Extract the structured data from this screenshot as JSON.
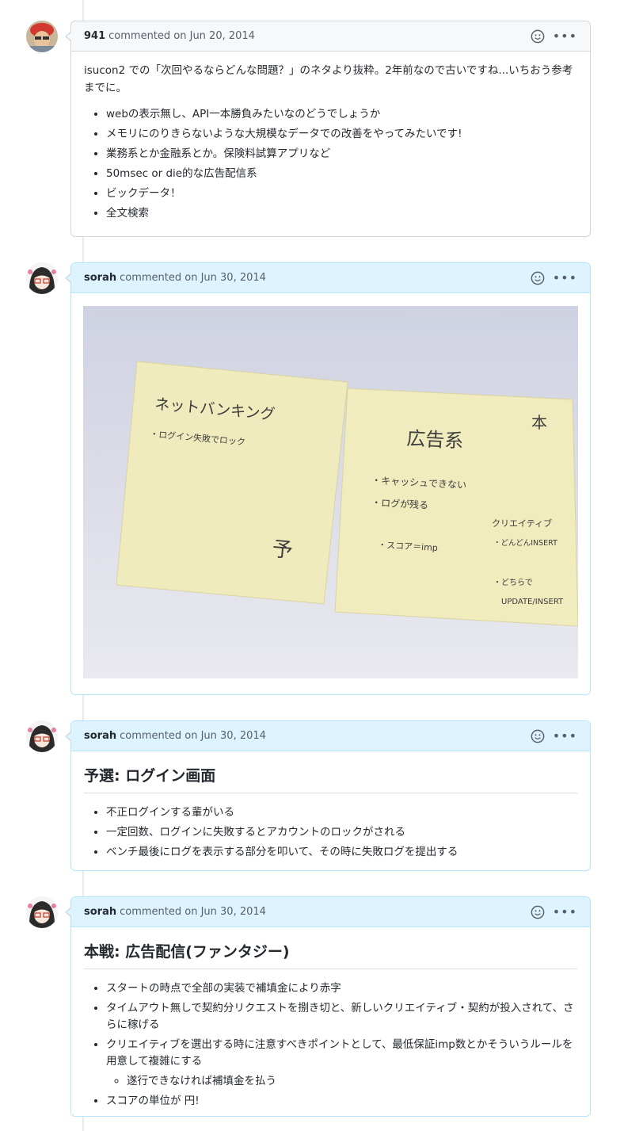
{
  "comments": [
    {
      "author": "941",
      "meta": "commented on Jun 20, 2014",
      "intro": "isucon2 での「次回やるならどんな問題？」のネタより抜粋。2年前なので古いですね...いちおう参考までに。",
      "items": [
        "webの表示無し、API一本勝負みたいなのどうでしょうか",
        "メモリにのりきらないような大規模なデータでの改善をやってみたいです!",
        "業務系とか金融系とか。保険料試算アプリなど",
        "50msec or die的な広告配信系",
        "ビックデータ！",
        "全文検索"
      ]
    },
    {
      "author": "sorah",
      "meta": "commented on Jun 30, 2014",
      "photo": {
        "note_left": {
          "title": "ネットバンキング",
          "line1": "・ログイン失敗でロック",
          "mark": "予"
        },
        "note_right": {
          "title": "広告系",
          "star": "本",
          "line1": "・キャッシュできない",
          "line2": "・ログが残る",
          "line3": "・スコア＝imp",
          "side1": "クリエイティブ",
          "side2": "・どんどんINSERT",
          "side3": "・どちらで",
          "side4": "UPDATE/INSERT"
        }
      }
    },
    {
      "author": "sorah",
      "meta": "commented on Jun 30, 2014",
      "heading": "予選: ログイン画面",
      "items": [
        "不正ログインする輩がいる",
        "一定回数、ログインに失敗するとアカウントのロックがされる",
        "ベンチ最後にログを表示する部分を叩いて、その時に失敗ログを提出する"
      ]
    },
    {
      "author": "sorah",
      "meta": "commented on Jun 30, 2014",
      "heading": "本戦: 広告配信(ファンタジー)",
      "items": [
        "スタートの時点で全部の実装で補填金により赤字",
        "タイムアウト無しで契約分リクエストを捌き切と、新しいクリエイティブ・契約が投入されて、さらに稼げる",
        "クリエイティブを選出する時に注意すべきポイントとして、最低保証imp数とかそういうルールを用意して複雑にする",
        "スコアの単位が 円!"
      ],
      "subitem": "遂行できなければ補填金を払う"
    }
  ],
  "icons": {
    "emoji": "smiley-icon",
    "more": "kebab-horizontal-icon"
  },
  "colors": {
    "header_gray": "#f6f8fa",
    "header_blue": "#ddf4ff",
    "border": "#d0d7de"
  }
}
